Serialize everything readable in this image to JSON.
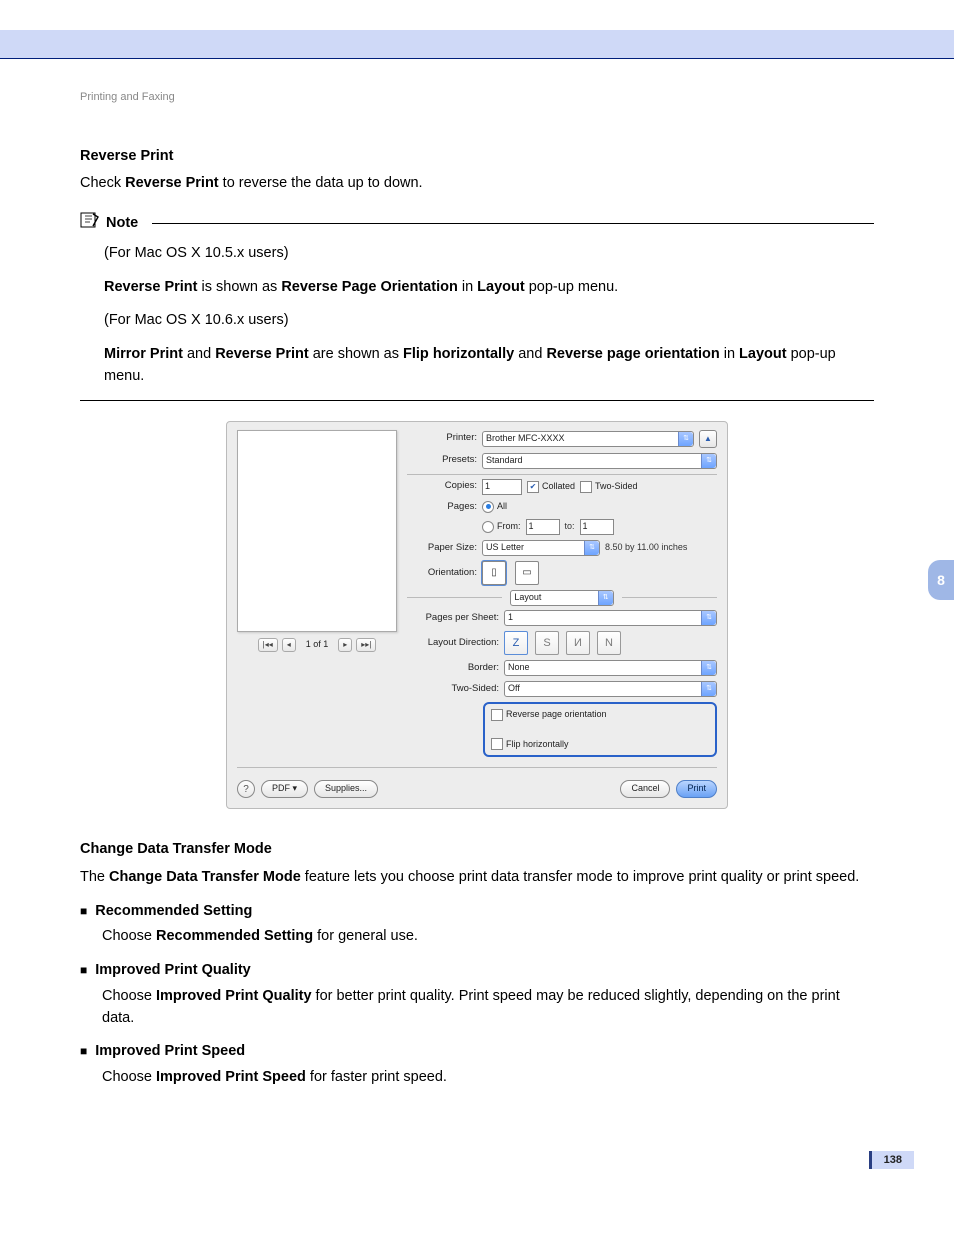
{
  "header": {
    "breadcrumb": "Printing and Faxing"
  },
  "section_reverse": {
    "title": "Reverse Print",
    "intro_pre": "Check ",
    "intro_bold": "Reverse Print",
    "intro_post": " to reverse the data up to down."
  },
  "note": {
    "label": "Note",
    "line1": "(For Mac OS X 10.5.x users)",
    "line2_b1": "Reverse Print",
    "line2_mid": " is shown as ",
    "line2_b2": "Reverse Page Orientation",
    "line2_mid2": " in ",
    "line2_b3": "Layout",
    "line2_post": " pop-up menu.",
    "line3": "(For Mac OS X 10.6.x users)",
    "line4_b1": "Mirror Print",
    "line4_and1": " and ",
    "line4_b2": "Reverse Print",
    "line4_mid": " are shown as ",
    "line4_b3": "Flip horizontally",
    "line4_and2": " and ",
    "line4_b4": "Reverse page orientation",
    "line4_in": " in ",
    "line4_b5": "Layout",
    "line4_post": " pop-up menu."
  },
  "dialog": {
    "labels": {
      "printer": "Printer:",
      "presets": "Presets:",
      "copies": "Copies:",
      "pages": "Pages:",
      "from": "From:",
      "to": "to:",
      "paper_size": "Paper Size:",
      "orientation": "Orientation:",
      "pps": "Pages per Sheet:",
      "layout_dir": "Layout Direction:",
      "border": "Border:",
      "two_sided": "Two-Sided:"
    },
    "values": {
      "printer": "Brother MFC-XXXX",
      "presets": "Standard",
      "copies": "1",
      "from": "1",
      "to": "1",
      "paper_size": "US Letter",
      "paper_dim": "8.50 by 11.00 inches",
      "section": "Layout",
      "pps": "1",
      "border": "None",
      "two_sided": "Off"
    },
    "checks": {
      "collated": "Collated",
      "two_sided_cb": "Two-Sided",
      "all": "All",
      "rev_orient": "Reverse page orientation",
      "flip": "Flip horizontally"
    },
    "preview_nav": "1 of 1",
    "footer": {
      "pdf": "PDF ▾",
      "supplies": "Supplies...",
      "cancel": "Cancel",
      "print": "Print"
    }
  },
  "section_cdtm": {
    "title": "Change Data Transfer Mode",
    "intro_pre": "The ",
    "intro_bold": "Change Data Transfer Mode",
    "intro_post": " feature lets you choose print data transfer mode to improve print quality or print speed.",
    "items": [
      {
        "title": "Recommended Setting",
        "desc_pre": "Choose ",
        "desc_bold": "Recommended Setting",
        "desc_post": " for general use."
      },
      {
        "title": "Improved Print Quality",
        "desc_pre": "Choose ",
        "desc_bold": "Improved Print Quality",
        "desc_post": " for better print quality. Print speed may be reduced slightly, depending on the print data."
      },
      {
        "title": "Improved Print Speed",
        "desc_pre": "Choose ",
        "desc_bold": "Improved Print Speed",
        "desc_post": " for faster print speed."
      }
    ]
  },
  "side_tab": "8",
  "page_number": "138"
}
